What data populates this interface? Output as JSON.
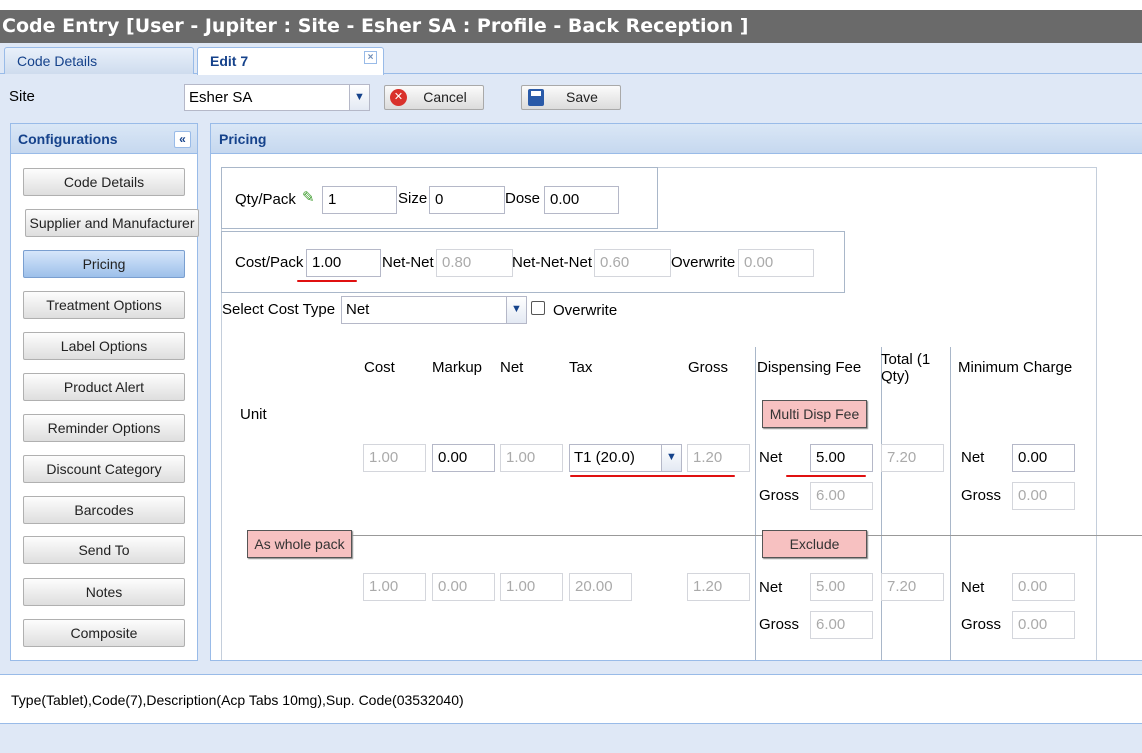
{
  "window": {
    "title": "Code Entry [User - Jupiter : Site - Esher SA : Profile - Back Reception ]"
  },
  "tabs": [
    {
      "label": "Code Details"
    },
    {
      "label": "Edit 7",
      "close": "×"
    }
  ],
  "site": {
    "label": "Site",
    "value": "Esher SA",
    "cancel_label": "Cancel",
    "save_label": "Save"
  },
  "configurations": {
    "title": "Configurations",
    "collapse": "«",
    "items": [
      "Code Details",
      "Supplier and Manufacturer",
      "Pricing",
      "Treatment Options",
      "Label Options",
      "Product Alert",
      "Reminder Options",
      "Discount Category",
      "Barcodes",
      "Send To",
      "Notes",
      "Composite"
    ],
    "active_index": 2
  },
  "pricing": {
    "title": "Pricing",
    "qty_pack": {
      "label": "Qty/Pack",
      "value": "1",
      "size_label": "Size",
      "size_value": "0",
      "dose_label": "Dose",
      "dose_value": "0.00"
    },
    "cost_pack": {
      "label": "Cost/Pack",
      "value": "1.00",
      "net_net_label": "Net-Net",
      "net_net_value": "0.80",
      "net_net_net_label": "Net-Net-Net",
      "net_net_net_value": "0.60",
      "overwrite_label": "Overwrite",
      "overwrite_value": "0.00"
    },
    "cost_type": {
      "label": "Select Cost Type",
      "value": "Net",
      "overwrite_label": "Overwrite"
    },
    "columns": {
      "cost": "Cost",
      "markup": "Markup",
      "net": "Net",
      "tax": "Tax",
      "gross": "Gross",
      "dispensing_fee": "Dispensing Fee",
      "total": "Total (1 Qty)",
      "minimum_charge": "Minimum Charge"
    },
    "unit": {
      "label": "Unit",
      "multi_disp_fee": "Multi Disp Fee",
      "cost": "1.00",
      "markup": "0.00",
      "net": "1.00",
      "tax": "T1 (20.0)",
      "gross": "1.20",
      "fee_net_label": "Net",
      "fee_net": "5.00",
      "fee_gross_label": "Gross",
      "fee_gross": "6.00",
      "total": "7.20",
      "min_net_label": "Net",
      "min_net": "0.00",
      "min_gross_label": "Gross",
      "min_gross": "0.00"
    },
    "pack": {
      "label": "As whole pack",
      "exclude": "Exclude",
      "cost": "1.00",
      "markup": "0.00",
      "net": "1.00",
      "tax": "20.00",
      "gross": "1.20",
      "fee_net_label": "Net",
      "fee_net": "5.00",
      "fee_gross_label": "Gross",
      "fee_gross": "6.00",
      "total": "7.20",
      "min_net_label": "Net",
      "min_net": "0.00",
      "min_gross_label": "Gross",
      "min_gross": "0.00"
    }
  },
  "status": {
    "text": "Type(Tablet),Code(7),Description(Acp Tabs 10mg),Sup. Code(03532040)"
  },
  "colors": {
    "title_bg": "#6a6a6a",
    "panel_header_text": "#15428b",
    "pink_button": "#f7c1c1",
    "annotation_red": "#e01010"
  }
}
